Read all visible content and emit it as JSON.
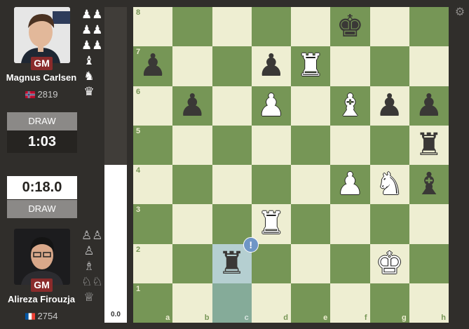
{
  "top_player": {
    "title": "GM",
    "name": "Magnus Carlsen",
    "rating": "2819",
    "country": "NO",
    "draw_label": "DRAW",
    "clock": "1:03",
    "captured": [
      "♟♟",
      "♟♟",
      "♟♟",
      "♝",
      "♞",
      "♛"
    ]
  },
  "bottom_player": {
    "title": "GM",
    "name": "Alireza Firouzja",
    "rating": "2754",
    "country": "FR",
    "draw_label": "DRAW",
    "clock": "0:18.0",
    "captured": [
      "♙♙",
      "♙",
      "♗",
      "♘♘",
      "♕"
    ]
  },
  "eval": {
    "text": "0.0",
    "white_fraction": 0.5
  },
  "board": {
    "ranks": [
      "8",
      "7",
      "6",
      "5",
      "4",
      "3",
      "2",
      "1"
    ],
    "files": [
      "a",
      "b",
      "c",
      "d",
      "e",
      "f",
      "g",
      "h"
    ],
    "pieces": {
      "f8": {
        "glyph": "♚",
        "color": "black",
        "name": "black-king"
      },
      "a7": {
        "glyph": "♟",
        "color": "black",
        "name": "black-pawn"
      },
      "d7": {
        "glyph": "♟",
        "color": "black",
        "name": "black-pawn"
      },
      "e7": {
        "glyph": "♜",
        "color": "white",
        "name": "white-rook"
      },
      "b6": {
        "glyph": "♟",
        "color": "black",
        "name": "black-pawn"
      },
      "d6": {
        "glyph": "♟",
        "color": "white",
        "name": "white-pawn"
      },
      "f6": {
        "glyph": "♝",
        "color": "white",
        "name": "white-bishop"
      },
      "g6": {
        "glyph": "♟",
        "color": "black",
        "name": "black-pawn"
      },
      "h6": {
        "glyph": "♟",
        "color": "black",
        "name": "black-pawn"
      },
      "h5": {
        "glyph": "♜",
        "color": "black",
        "name": "black-rook"
      },
      "f4": {
        "glyph": "♟",
        "color": "white",
        "name": "white-pawn"
      },
      "g4": {
        "glyph": "♞",
        "color": "white",
        "name": "white-knight"
      },
      "h4": {
        "glyph": "♝",
        "color": "black",
        "name": "black-bishop"
      },
      "d3": {
        "glyph": "♜",
        "color": "white",
        "name": "white-rook"
      },
      "c2": {
        "glyph": "♜",
        "color": "black",
        "name": "black-rook"
      },
      "g2": {
        "glyph": "♚",
        "color": "white",
        "name": "white-king"
      }
    },
    "highlighted": [
      "c2",
      "c1"
    ],
    "alert_square": "c2",
    "alert_symbol": "!"
  },
  "settings_icon": "gear-icon"
}
